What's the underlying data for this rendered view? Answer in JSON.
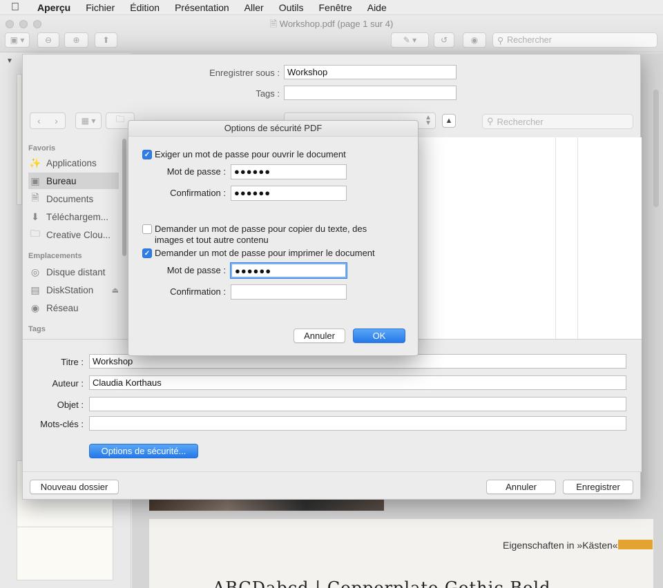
{
  "menubar": {
    "app": "Aperçu",
    "items": [
      "Fichier",
      "Édition",
      "Présentation",
      "Aller",
      "Outils",
      "Fenêtre",
      "Aide"
    ]
  },
  "window": {
    "title": "Workshop.pdf (page 1 sur 4)",
    "search_placeholder": "Rechercher",
    "sidebar_collapse": "▼"
  },
  "document": {
    "page2_heading": "Eigenschaften in »Kästen«",
    "page2_big": "ABCDabcd | Copperplate Gothic Bold",
    "accent_color": "#e4a32e"
  },
  "save_sheet": {
    "save_as_label": "Enregistrer sous :",
    "save_as_value": "Workshop",
    "tags_label": "Tags :",
    "tags_value": "",
    "search_placeholder": "Rechercher",
    "sidebar": {
      "favorites_header": "Favoris",
      "favorites": [
        {
          "label": "Applications",
          "icon": "apps-icon"
        },
        {
          "label": "Bureau",
          "icon": "desktop-icon",
          "selected": true
        },
        {
          "label": "Documents",
          "icon": "documents-icon"
        },
        {
          "label": "Téléchargem...",
          "icon": "download-icon"
        },
        {
          "label": "Creative Clou...",
          "icon": "folder-icon"
        }
      ],
      "locations_header": "Emplacements",
      "locations": [
        {
          "label": "Disque distant",
          "icon": "disk-icon"
        },
        {
          "label": "DiskStation",
          "icon": "server-icon"
        },
        {
          "label": "Réseau",
          "icon": "network-icon"
        }
      ],
      "tags_header": "Tags"
    },
    "meta": {
      "title_label": "Titre :",
      "title_value": "Workshop",
      "author_label": "Auteur :",
      "author_value": "Claudia Korthaus",
      "subject_label": "Objet :",
      "subject_value": "",
      "keywords_label": "Mots-clés :",
      "keywords_value": "",
      "security_button": "Options de sécurité..."
    },
    "footer": {
      "new_folder": "Nouveau dossier",
      "cancel": "Annuler",
      "save": "Enregistrer"
    }
  },
  "security_dialog": {
    "title": "Options de sécurité PDF",
    "open_required": {
      "label": "Exiger un mot de passe pour ouvrir le document",
      "checked": true
    },
    "open_password_label": "Mot de passe :",
    "open_password_value": "●●●●●●",
    "open_confirm_label": "Confirmation :",
    "open_confirm_value": "●●●●●●",
    "copy_required": {
      "label": "Demander un mot de passe pour copier du texte, des images et tout autre contenu",
      "checked": false
    },
    "print_required": {
      "label": "Demander un mot de passe pour imprimer le document",
      "checked": true
    },
    "print_password_label": "Mot de passe :",
    "print_password_value": "●●●●●●",
    "print_confirm_label": "Confirmation :",
    "print_confirm_value": "",
    "cancel": "Annuler",
    "ok": "OK",
    "check_glyph": "✓"
  }
}
